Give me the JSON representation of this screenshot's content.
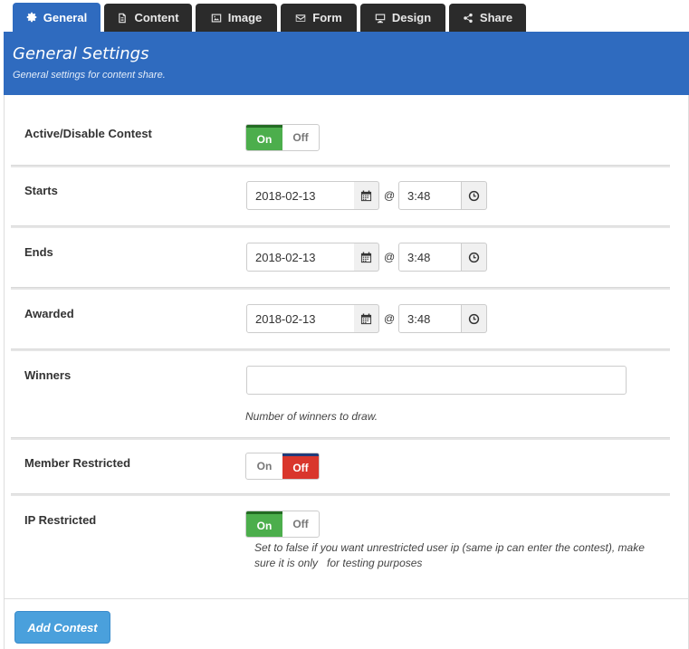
{
  "tabs": [
    {
      "label": "General",
      "icon": "gear-icon",
      "active": true
    },
    {
      "label": "Content",
      "icon": "document-icon",
      "active": false
    },
    {
      "label": "Image",
      "icon": "image-icon",
      "active": false
    },
    {
      "label": "Form",
      "icon": "envelope-icon",
      "active": false
    },
    {
      "label": "Design",
      "icon": "monitor-icon",
      "active": false
    },
    {
      "label": "Share",
      "icon": "share-icon",
      "active": false
    }
  ],
  "header": {
    "title": "General Settings",
    "subtitle": "General settings for content share."
  },
  "colors": {
    "accent": "#2f6bbf",
    "on": "#4cae4c",
    "off": "#d9362c",
    "button": "#4aa0dc"
  },
  "toggle_labels": {
    "on": "On",
    "off": "Off"
  },
  "at_symbol": "@",
  "fields": {
    "active": {
      "label": "Active/Disable Contest",
      "state": "on"
    },
    "starts": {
      "label": "Starts",
      "date": "2018-02-13",
      "time": "3:48"
    },
    "ends": {
      "label": "Ends",
      "date": "2018-02-13",
      "time": "3:48"
    },
    "awarded": {
      "label": "Awarded",
      "date": "2018-02-13",
      "time": "3:48"
    },
    "winners": {
      "label": "Winners",
      "value": "",
      "help": "Number of winners to draw."
    },
    "member_restricted": {
      "label": "Member Restricted",
      "state": "off"
    },
    "ip_restricted": {
      "label": "IP Restricted",
      "state": "on",
      "help_line1": "Set to false if you want unrestricted user ip (same ip can enter the contest), make",
      "help_line2": "sure it is only   for testing purposes"
    }
  },
  "footer": {
    "add_button": "Add Contest"
  }
}
